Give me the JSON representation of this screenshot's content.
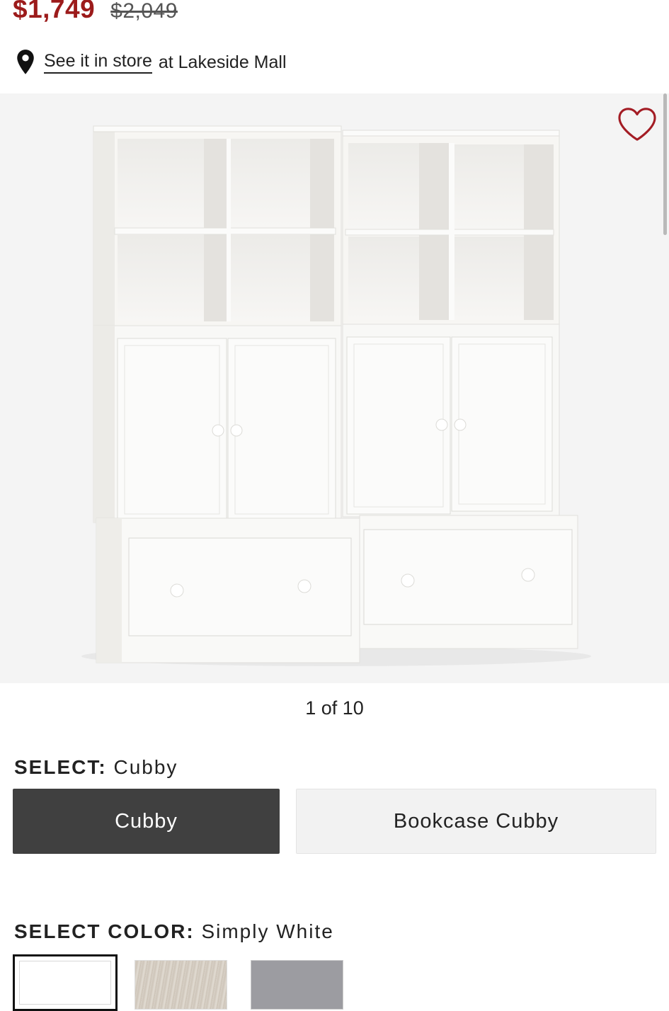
{
  "price": {
    "sale": "$1,749",
    "original": "$2,049"
  },
  "store": {
    "link_text": "See it in store",
    "suffix": "at Lakeside Mall"
  },
  "gallery": {
    "counter": "1 of 10"
  },
  "configuration": {
    "label": "SELECT:",
    "selected": "Cubby",
    "options": [
      {
        "label": "Cubby"
      },
      {
        "label": "Bookcase Cubby"
      }
    ]
  },
  "color": {
    "label": "SELECT COLOR:",
    "selected": "Simply White"
  },
  "colors": {
    "sale": "#9c1b1b",
    "selected_option_bg": "#404040"
  },
  "icons": [
    "location-pin-icon",
    "heart-icon"
  ]
}
